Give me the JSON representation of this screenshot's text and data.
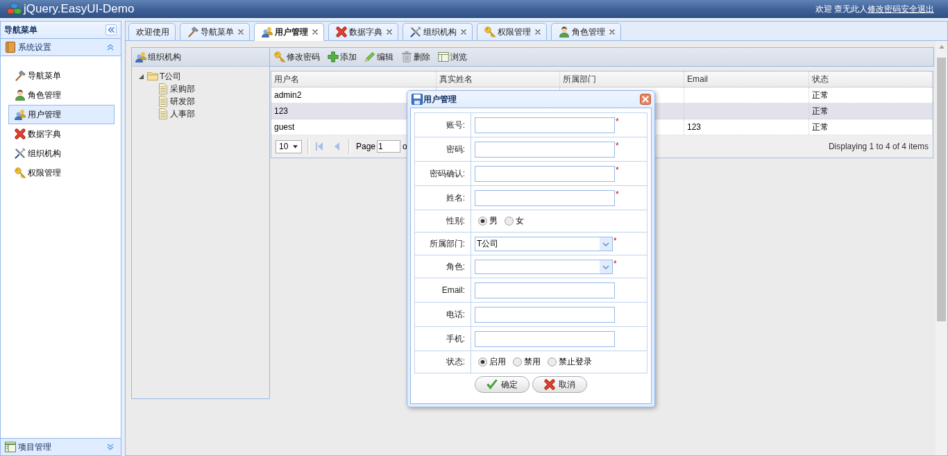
{
  "header": {
    "title": "jQuery.EasyUI-Demo",
    "greeting": "欢迎 查无此人",
    "links": [
      "修改密码",
      "安全退出"
    ]
  },
  "sidebar": {
    "title": "导航菜单",
    "sections": [
      {
        "title": "系统设置",
        "kind": "box",
        "expanded": true,
        "items": [
          {
            "label": "导航菜单",
            "kind": "hammer",
            "selected": false
          },
          {
            "label": "角色管理",
            "kind": "person",
            "selected": false
          },
          {
            "label": "用户管理",
            "kind": "people",
            "selected": true
          },
          {
            "label": "数据字典",
            "kind": "cross",
            "selected": false
          },
          {
            "label": "组织机构",
            "kind": "tools",
            "selected": false
          },
          {
            "label": "权限管理",
            "kind": "key",
            "selected": false
          }
        ]
      },
      {
        "title": "项目管理",
        "kind": "grid",
        "expanded": false
      }
    ]
  },
  "tabs": [
    {
      "label": "欢迎使用",
      "kind": "plain",
      "closable": false,
      "selected": false
    },
    {
      "label": "导航菜单",
      "kind": "hammer",
      "closable": true,
      "selected": false
    },
    {
      "label": "用户管理",
      "kind": "people",
      "closable": true,
      "selected": true
    },
    {
      "label": "数据字典",
      "kind": "cross",
      "closable": true,
      "selected": false
    },
    {
      "label": "组织机构",
      "kind": "tools",
      "closable": true,
      "selected": false
    },
    {
      "label": "权限管理",
      "kind": "key",
      "closable": true,
      "selected": false
    },
    {
      "label": "角色管理",
      "kind": "person",
      "closable": true,
      "selected": false
    }
  ],
  "tree_panel": {
    "title": "组织机构",
    "nodes": [
      {
        "label": "T公司",
        "expanded": true,
        "children": [
          {
            "label": "采购部"
          },
          {
            "label": "研发部"
          },
          {
            "label": "人事部"
          }
        ]
      }
    ]
  },
  "toolbar": [
    {
      "label": "修改密码",
      "kind": "key"
    },
    {
      "label": "添加",
      "kind": "add"
    },
    {
      "label": "编辑",
      "kind": "edit"
    },
    {
      "label": "删除",
      "kind": "remove"
    },
    {
      "label": "浏览",
      "kind": "view"
    }
  ],
  "grid": {
    "columns": [
      "用户名",
      "真实姓名",
      "所属部门",
      "Email",
      "状态"
    ],
    "rows": [
      {
        "username": "admin2",
        "status": "正常",
        "selected": false
      },
      {
        "username": "123",
        "status": "正常",
        "selected": true
      },
      {
        "username": "guest",
        "email": "123",
        "status": "正常",
        "selected": false
      }
    ],
    "pager": {
      "page_size": "10",
      "page_label": "Page",
      "page": "1",
      "of_label": "o",
      "info": "Displaying 1 to 4 of 4 items"
    }
  },
  "dialog": {
    "title": "用户管理",
    "fields": [
      {
        "label": "账号:",
        "kind": "text",
        "mark": "*"
      },
      {
        "label": "密码:",
        "kind": "text",
        "mark": "*"
      },
      {
        "label": "密码确认:",
        "kind": "text",
        "mark": "*"
      },
      {
        "label": "姓名:",
        "kind": "text",
        "mark": "*"
      },
      {
        "label": "性别:",
        "kind": "radio",
        "options": [
          {
            "label": "男",
            "selected": true
          },
          {
            "label": "女",
            "selected": false
          }
        ]
      },
      {
        "label": "所属部门:",
        "kind": "combo",
        "value": "T公司",
        "mark": "*"
      },
      {
        "label": "角色:",
        "kind": "combo",
        "mark": "*"
      },
      {
        "label": "Email:",
        "kind": "text"
      },
      {
        "label": "电话:",
        "kind": "text"
      },
      {
        "label": "手机:",
        "kind": "text"
      },
      {
        "label": "状态:",
        "kind": "radio",
        "options": [
          {
            "label": "启用",
            "selected": true
          },
          {
            "label": "禁用",
            "selected": false
          },
          {
            "label": "禁止登录",
            "selected": false
          }
        ]
      }
    ],
    "buttons": [
      {
        "label": "确定",
        "kind": "ok"
      },
      {
        "label": "取消",
        "kind": "cancel"
      }
    ]
  }
}
